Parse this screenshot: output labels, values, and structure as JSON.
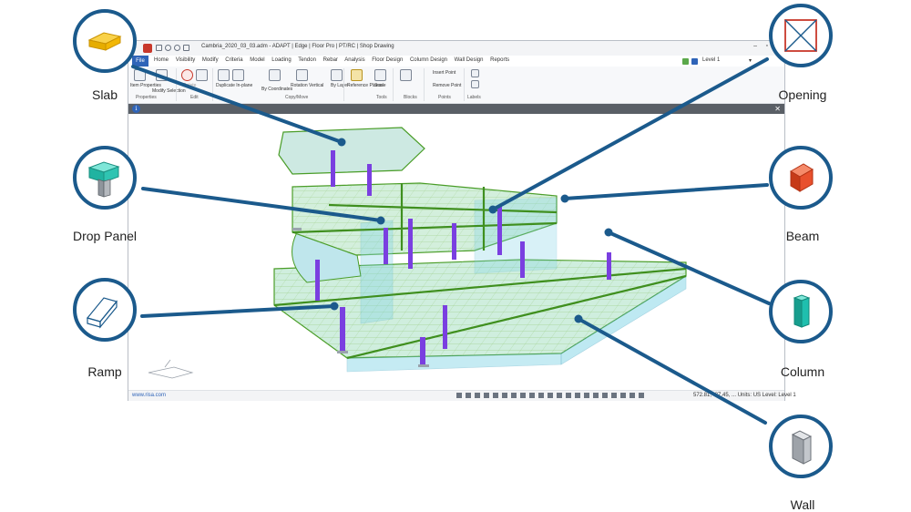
{
  "window": {
    "title": "Cambria_2020_03_03.adm - ADAPT | Edge | Floor Pro | PT/RC | Shop Drawing",
    "file_tab": "File",
    "menu_tabs": [
      "Home",
      "Visibility",
      "Modify",
      "Criteria",
      "Model",
      "Loading",
      "Tendon",
      "Rebar",
      "Analysis",
      "Floor Design",
      "Column Design",
      "Wall Design",
      "Reports"
    ],
    "level_selector": "Level 1"
  },
  "ribbon": {
    "buttons": {
      "item_properties": "Item Properties",
      "modify_selection": "Modify Selection",
      "delete": "Delete",
      "duplicate_inplane": "Duplicate In-plane",
      "by_coordinates": "By Coordinates",
      "rotation_vertical": "Rotation Vertical",
      "by_layer": "By Layer",
      "reference_planes": "Reference Planes",
      "scale": "Scale",
      "insert_point": "Insert Point",
      "remove_point": "Remove Point"
    },
    "groups": {
      "properties": "Properties",
      "edit": "Edit",
      "copy_move": "Copy/Move",
      "tools": "Tools",
      "blocks": "Blocks",
      "points": "Points",
      "labels": "Labels"
    }
  },
  "status_bar": {
    "link": "www.risa.com",
    "coords": "572.81, -87.45, ...",
    "units": "Units: US",
    "level": "Level: Level 1"
  },
  "callouts": [
    {
      "id": "slab",
      "label": "Slab",
      "icon": "slab-icon",
      "color": "#f2b705"
    },
    {
      "id": "drop-panel",
      "label": "Drop Panel",
      "icon": "drop-panel-icon",
      "color": "#2fc4b2"
    },
    {
      "id": "ramp",
      "label": "Ramp",
      "icon": "ramp-icon",
      "color": "#1b5a8c"
    },
    {
      "id": "opening",
      "label": "Opening",
      "icon": "opening-icon",
      "color": "#c8382b"
    },
    {
      "id": "beam",
      "label": "Beam",
      "icon": "beam-icon",
      "color": "#e8502d"
    },
    {
      "id": "column",
      "label": "Column",
      "icon": "column-icon",
      "color": "#1fbfae"
    },
    {
      "id": "wall",
      "label": "Wall",
      "icon": "wall-icon",
      "color": "#b5b9be"
    }
  ],
  "colors": {
    "callout_ring": "#1b5a8c",
    "model_edge": "#4a9d28",
    "model_fill": "#c9ecd8",
    "column": "#7a3fe0"
  }
}
